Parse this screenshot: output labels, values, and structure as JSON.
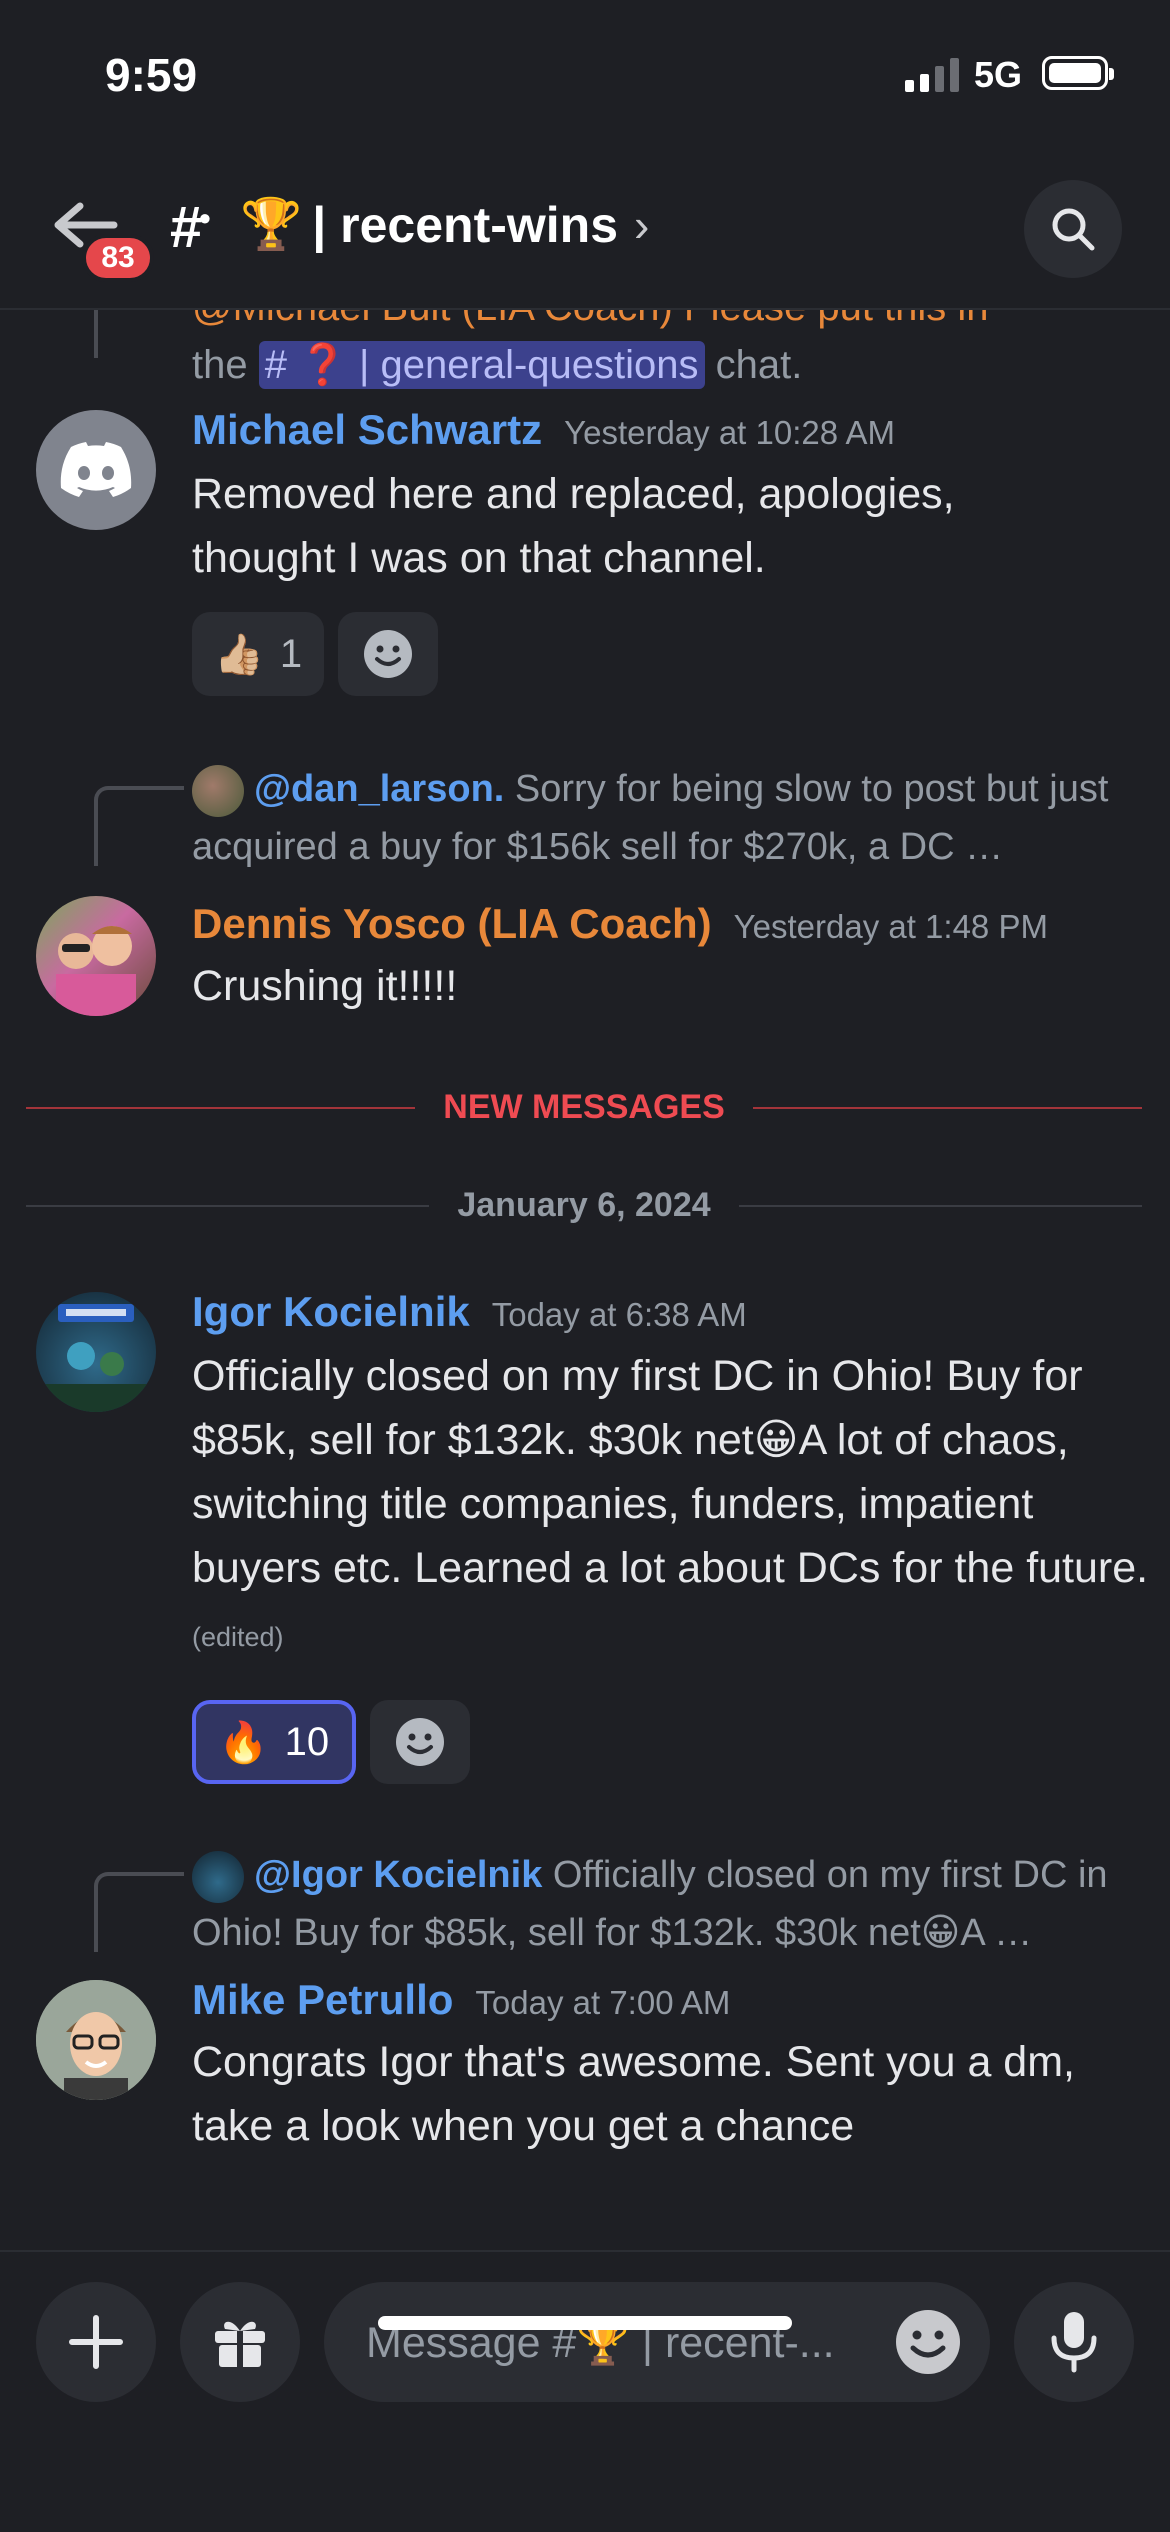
{
  "status": {
    "time": "9:59",
    "network": "5G"
  },
  "header": {
    "badge": "83",
    "channel_emoji": "🏆",
    "channel_name": "| recent-wins",
    "chevron": "›"
  },
  "messages": {
    "m0": {
      "partial_top": "@Michael Bult (LIA Coach) Please put this in",
      "line_pre": "the",
      "channel_mention": "# ❓ | general-questions",
      "line_post": "chat."
    },
    "m1": {
      "author": "Michael Schwartz",
      "timestamp": "Yesterday at 10:28 AM",
      "body": "Removed here and replaced, apologies, thought I was on that channel.",
      "reactions": [
        {
          "emoji": "👍🏼",
          "count": "1"
        }
      ]
    },
    "m2": {
      "reply_mention": "@dan_larson.",
      "reply_text": " Sorry for being slow to post but just acquired a buy for $156k sell for $270k, a DC …",
      "author": "Dennis Yosco (LIA Coach)",
      "timestamp": "Yesterday at 1:48 PM",
      "body": "Crushing it!!!!!"
    },
    "new_messages_label": "NEW MESSAGES",
    "date_label": "January 6, 2024",
    "m3": {
      "author": "Igor Kocielnik",
      "timestamp": "Today at 6:38 AM",
      "body": "Officially closed on my first DC in Ohio! Buy for $85k, sell for $132k. $30k net😀A lot of chaos, switching title companies, funders, impatient buyers etc. Learned a lot about DCs for the future.",
      "edited": "(edited)",
      "reactions": [
        {
          "emoji": "🔥",
          "count": "10"
        }
      ]
    },
    "m4": {
      "reply_mention": "@Igor Kocielnik",
      "reply_text": " Officially closed on my first DC in Ohio! Buy for $85k, sell for $132k. $30k net😀A …",
      "author": "Mike Petrullo",
      "timestamp": "Today at 7:00 AM",
      "body": "Congrats Igor that's awesome. Sent you a dm, take a look when you get a chance"
    }
  },
  "composer": {
    "placeholder": "Message #🏆 | recent-..."
  },
  "colors": {
    "background": "#1e1f24",
    "blue_name": "#5d9ef0",
    "orange_name": "#e8883a",
    "new_messages": "#ef4b52",
    "blurple": "#5865f2"
  },
  "icons": [
    "back-arrow-icon",
    "channel-hash-icon",
    "search-icon",
    "discord-logo-icon",
    "add-reaction-icon",
    "plus-icon",
    "gift-icon",
    "emoji-icon",
    "microphone-icon"
  ]
}
